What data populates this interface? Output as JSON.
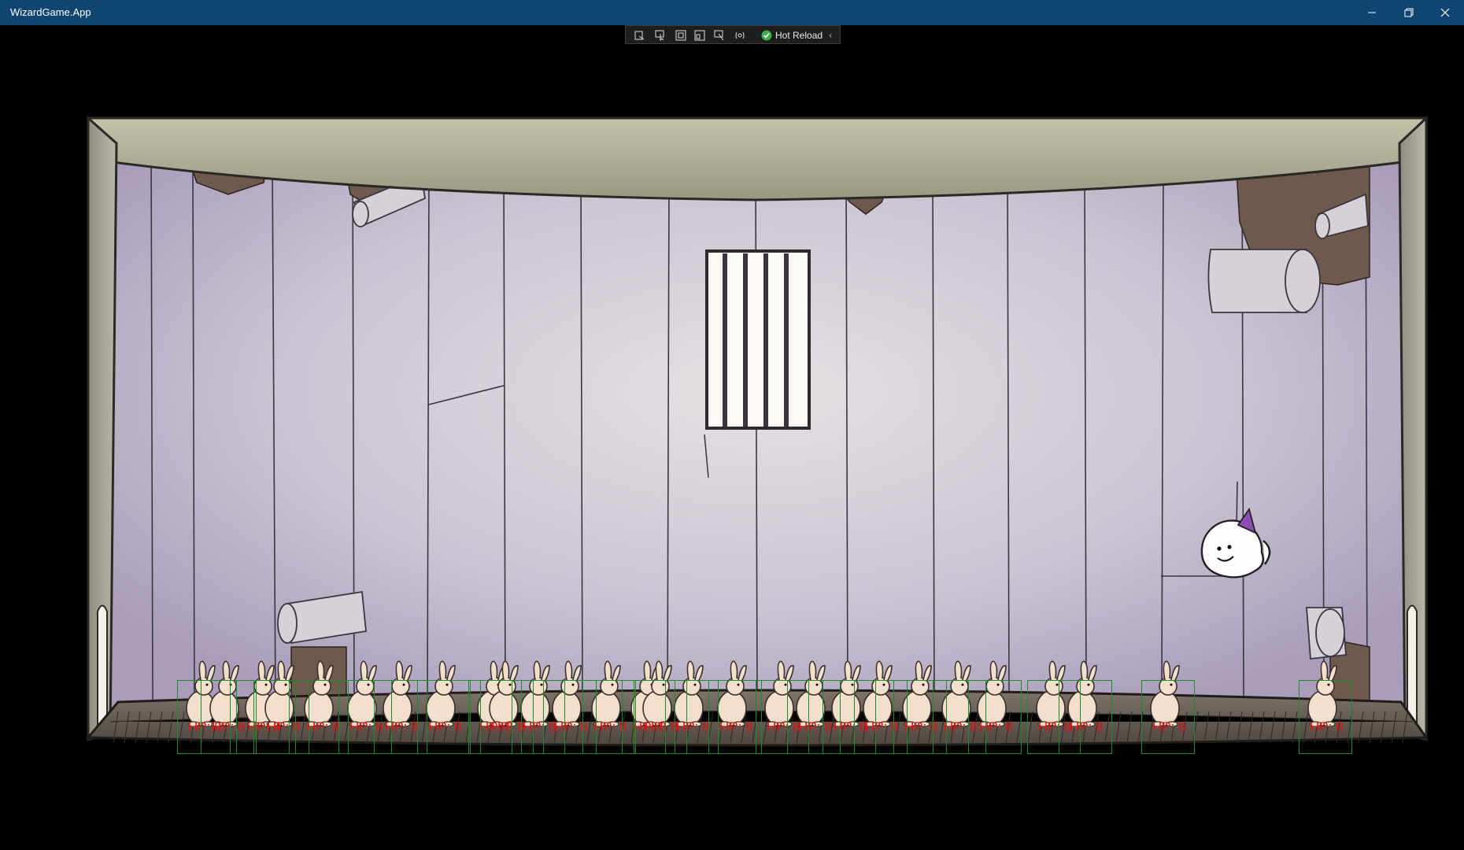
{
  "window": {
    "title": "WizardGame.App"
  },
  "debug_toolbar": {
    "tools": [
      "live-visual-tree-icon",
      "select-element-icon",
      "display-layout-adorners-icon",
      "track-focus-icon",
      "show-binding-failures-icon",
      "binding-icon"
    ],
    "hot_reload_label": "Hot Reload",
    "hot_reload_status": "ok"
  },
  "scene": {
    "player": "wizard-ghost",
    "enemy_type": "bunny",
    "hp_prefix": "HP: ",
    "enemy_hp": 8
  },
  "enemies": [
    {
      "id": 1,
      "hp_text": "HP: 8"
    },
    {
      "id": 2,
      "hp_text": "HP: 8"
    },
    {
      "id": 3,
      "hp_text": "HP: 8"
    },
    {
      "id": 4,
      "hp_text": "HP: 8"
    },
    {
      "id": 5,
      "hp_text": "HP: 8"
    },
    {
      "id": 6,
      "hp_text": "HP: 8"
    },
    {
      "id": 7,
      "hp_text": "HP: 8"
    },
    {
      "id": 8,
      "hp_text": "HP: 8"
    },
    {
      "id": 9,
      "hp_text": "HP: 8"
    },
    {
      "id": 10,
      "hp_text": "HP: 8"
    },
    {
      "id": 11,
      "hp_text": "HP: 8"
    },
    {
      "id": 12,
      "hp_text": "HP: 8"
    },
    {
      "id": 13,
      "hp_text": "HP: 8"
    },
    {
      "id": 14,
      "hp_text": "HP: 8"
    },
    {
      "id": 15,
      "hp_text": "HP: 8"
    },
    {
      "id": 16,
      "hp_text": "HP: 8"
    },
    {
      "id": 17,
      "hp_text": "HP: 8"
    },
    {
      "id": 18,
      "hp_text": "HP: 8"
    },
    {
      "id": 19,
      "hp_text": "HP: 8"
    },
    {
      "id": 20,
      "hp_text": "HP: 8"
    },
    {
      "id": 21,
      "hp_text": "HP: 8"
    },
    {
      "id": 22,
      "hp_text": "HP: 8"
    },
    {
      "id": 23,
      "hp_text": "HP: 8"
    },
    {
      "id": 24,
      "hp_text": "HP: 8"
    },
    {
      "id": 25,
      "hp_text": "HP: 8"
    },
    {
      "id": 26,
      "hp_text": "HP: 8"
    },
    {
      "id": 27,
      "hp_text": "HP: 8"
    },
    {
      "id": 28,
      "hp_text": "HP: 8"
    }
  ],
  "colors": {
    "titlebar": "#0f4570",
    "hp_text": "#e10f0f",
    "hitbox": "#1f8a2a",
    "wall": "#c9c0d4",
    "floor": "#6b625a"
  }
}
